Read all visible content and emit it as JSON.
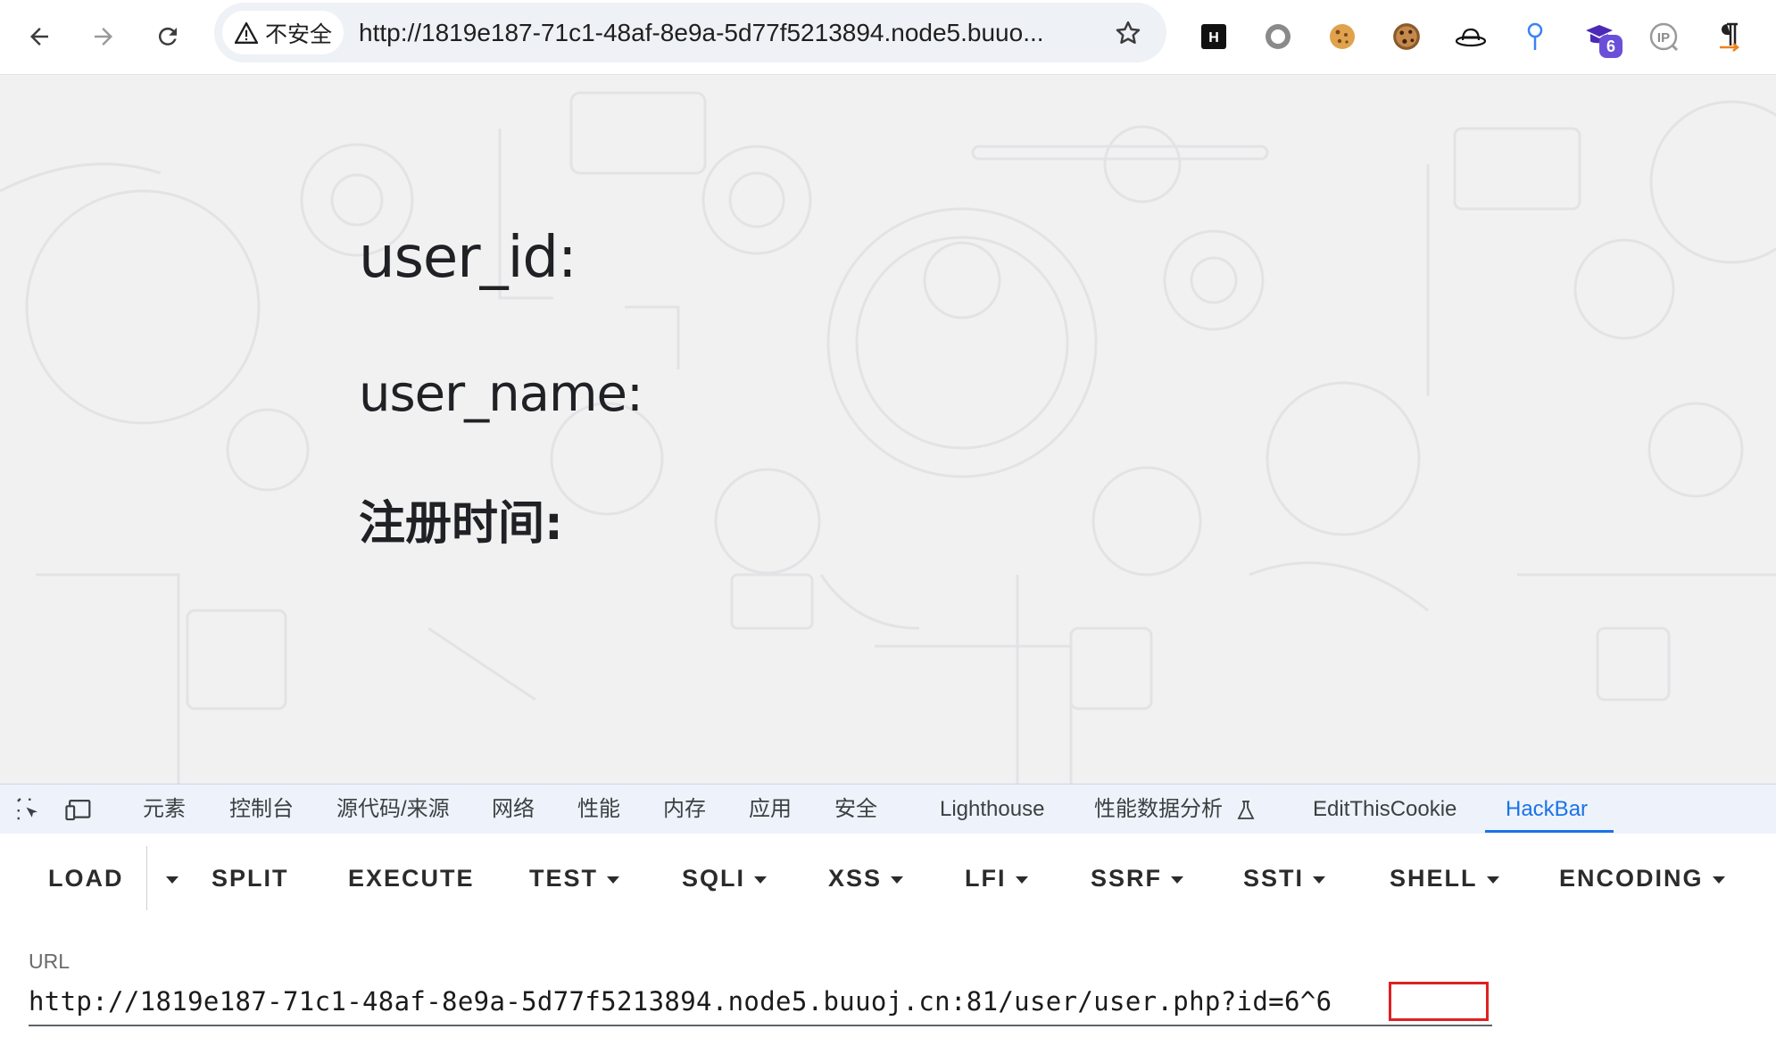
{
  "browser": {
    "security_label": "不安全",
    "address": "http://1819e187-71c1-48af-8e9a-5d77f5213894.node5.buuo...",
    "extensions": [
      {
        "name": "hackertarget-icon",
        "letter": "H"
      },
      {
        "name": "circle-extension-icon"
      },
      {
        "name": "cookie-icon"
      },
      {
        "name": "cookie-editor-icon"
      },
      {
        "name": "hat-icon"
      },
      {
        "name": "pin-icon"
      },
      {
        "name": "wappalyzer-icon",
        "badge": "6"
      },
      {
        "name": "ip-icon",
        "letter": "IP"
      },
      {
        "name": "pilcrow-icon"
      }
    ]
  },
  "page": {
    "user_id_label": "user_id:",
    "user_name_label": "user_name:",
    "register_time_label": "注册时间:"
  },
  "devtools": {
    "tabs": [
      "元素",
      "控制台",
      "源代码/来源",
      "网络",
      "性能",
      "内存",
      "应用",
      "安全",
      "Lighthouse",
      "性能数据分析",
      "EditThisCookie",
      "HackBar"
    ],
    "active_tab": "HackBar"
  },
  "hackbar": {
    "buttons": [
      "LOAD",
      "SPLIT",
      "EXECUTE",
      "TEST",
      "SQLI",
      "XSS",
      "LFI",
      "SSRF",
      "SSTI",
      "SHELL",
      "ENCODING"
    ],
    "url_label": "URL",
    "url_value": "http://1819e187-71c1-48af-8e9a-5d77f5213894.node5.buuoj.cn:81/user/user.php?id=6^6"
  },
  "colors": {
    "accent": "#1a73e8",
    "highlight": "#e02020",
    "page_bg": "#f1f1f2"
  }
}
